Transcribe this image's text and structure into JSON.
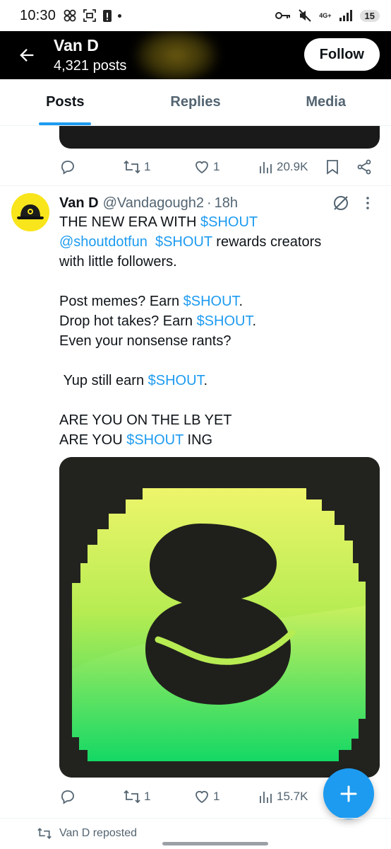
{
  "status_bar": {
    "time": "10:30",
    "network": "4G+",
    "notifications_badge": "15"
  },
  "header": {
    "name": "Van D",
    "posts_count": "4,321 posts",
    "follow_label": "Follow"
  },
  "tabs": [
    {
      "label": "Posts",
      "active": true
    },
    {
      "label": "Replies",
      "active": false
    },
    {
      "label": "Media",
      "active": false
    }
  ],
  "prev_tweet": {
    "reposts": "1",
    "likes": "1",
    "views": "20.9K"
  },
  "tweet": {
    "name": "Van D",
    "handle": "@Vandagough2",
    "separator": "·",
    "time": "18h",
    "lines": [
      [
        {
          "t": "THE NEW ERA WITH "
        },
        {
          "t": "$SHOUT",
          "hl": true
        }
      ],
      [
        {
          "t": "@shoutdotfun",
          "hl": true
        },
        {
          "t": "  "
        },
        {
          "t": "$SHOUT",
          "hl": true
        },
        {
          "t": " rewards creators"
        }
      ],
      [
        {
          "t": "with little followers."
        }
      ],
      [],
      [
        {
          "t": "Post memes? Earn "
        },
        {
          "t": "$SHOUT",
          "hl": true
        },
        {
          "t": "."
        }
      ],
      [
        {
          "t": "Drop hot takes? Earn "
        },
        {
          "t": "$SHOUT",
          "hl": true
        },
        {
          "t": "."
        }
      ],
      [
        {
          "t": "Even your nonsense rants?"
        }
      ],
      [],
      [
        {
          "t": " Yup still earn "
        },
        {
          "t": "$SHOUT",
          "hl": true
        },
        {
          "t": "."
        }
      ],
      [],
      [
        {
          "t": "ARE YOU ON THE LB YET"
        }
      ],
      [
        {
          "t": "ARE YOU "
        },
        {
          "t": "$SHOUT",
          "hl": true
        },
        {
          "t": " ING"
        }
      ]
    ],
    "reposts": "1",
    "likes": "1",
    "views": "15.7K"
  },
  "next_item": {
    "repost_label": "Van D reposted"
  },
  "colors": {
    "accent": "#1d9bf0",
    "text": "#0f1419",
    "muted": "#536471",
    "avatar_bg": "#f9e51c",
    "media_green": "#2edb6f",
    "media_yellow": "#e8f56a"
  }
}
